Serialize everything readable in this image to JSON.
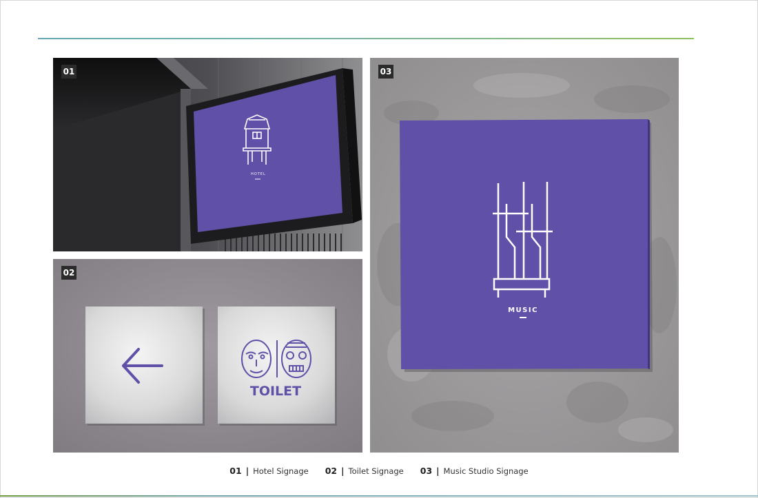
{
  "panels": [
    {
      "number": "01",
      "sign_text": "HOTEL",
      "icon": "temple-gate-icon"
    },
    {
      "number": "02",
      "sign_text": "TOILET",
      "icons": [
        "arrow-left-icon",
        "mask-icon"
      ]
    },
    {
      "number": "03",
      "sign_text": "MUSIC",
      "icon": "angklung-icon"
    }
  ],
  "captions": [
    {
      "number": "01",
      "separator": "|",
      "label": "Hotel Signage"
    },
    {
      "number": "02",
      "separator": "|",
      "label": "Toilet Signage"
    },
    {
      "number": "03",
      "separator": "|",
      "label": "Music Studio Signage"
    }
  ],
  "colors": {
    "sign_purple": "#6050a8",
    "concrete": "#9a9898",
    "badge": "#2b2b2b"
  }
}
